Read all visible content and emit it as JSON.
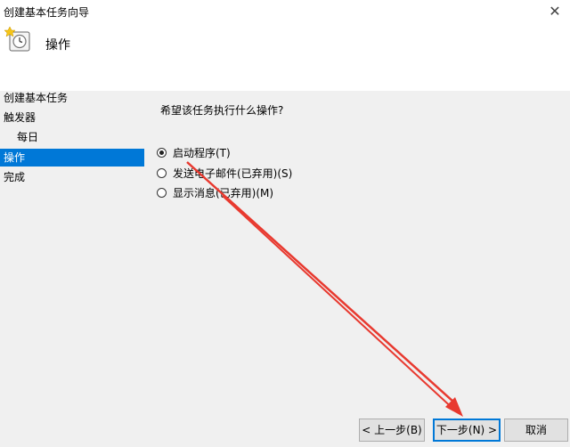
{
  "window": {
    "title": "创建基本任务向导"
  },
  "header": {
    "title": "操作"
  },
  "nav": {
    "items": [
      {
        "label": "创建基本任务",
        "sub": false,
        "selected": false
      },
      {
        "label": "触发器",
        "sub": false,
        "selected": false
      },
      {
        "label": "每日",
        "sub": true,
        "selected": false
      },
      {
        "label": "操作",
        "sub": false,
        "selected": true
      },
      {
        "label": "完成",
        "sub": false,
        "selected": false
      }
    ]
  },
  "main": {
    "question": "希望该任务执行什么操作?",
    "options": [
      {
        "label": "启动程序(T)",
        "checked": true
      },
      {
        "label": "发送电子邮件(已弃用)(S)",
        "checked": false
      },
      {
        "label": "显示消息(已弃用)(M)",
        "checked": false
      }
    ]
  },
  "buttons": {
    "back": "< 上一步(B)",
    "next": "下一步(N) >",
    "cancel": "取消"
  },
  "colors": {
    "selection": "#0078d7",
    "arrow": "#e8392f",
    "panel": "#f0f0f0"
  },
  "icons": {
    "header": "scheduled-task-clock-icon",
    "close": "close-icon"
  }
}
